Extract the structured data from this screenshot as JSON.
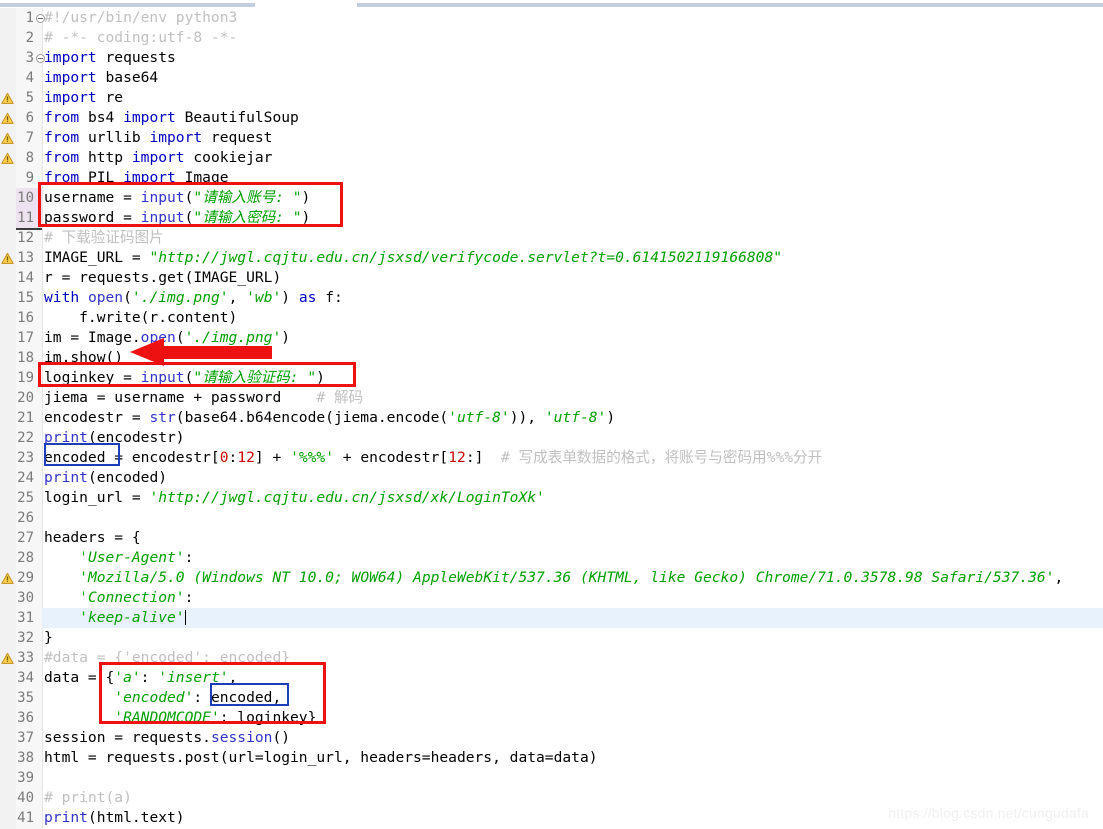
{
  "editor": {
    "title": "python-code-editor",
    "language": "Python",
    "current_line": 31,
    "watermark": "https://blog.csdn.net/cungudafa",
    "colors": {
      "string": "#00a000",
      "keyword": "#7f0055",
      "builtin": "#5050c8",
      "comment": "#c0c0c0",
      "number": "#cc0000",
      "annotation_red": "#ee1111",
      "annotation_blue": "#1b3fbb",
      "current_line_bg": "#e8f2fc",
      "changed_line_bg": "#ede3f0",
      "gutter_bg": "#f7f7f7"
    }
  },
  "lines": [
    {
      "n": 1,
      "warn": false,
      "fold": true,
      "text": "#!/usr/bin/env python3"
    },
    {
      "n": 2,
      "warn": false,
      "fold": false,
      "text": "# -*- coding:utf-8 -*-"
    },
    {
      "n": 3,
      "warn": false,
      "fold": true,
      "text": "import requests"
    },
    {
      "n": 4,
      "warn": false,
      "fold": false,
      "text": "import base64"
    },
    {
      "n": 5,
      "warn": true,
      "fold": false,
      "text": "import re"
    },
    {
      "n": 6,
      "warn": true,
      "fold": false,
      "text": "from bs4 import BeautifulSoup"
    },
    {
      "n": 7,
      "warn": true,
      "fold": false,
      "text": "from urllib import request"
    },
    {
      "n": 8,
      "warn": true,
      "fold": false,
      "text": "from http import cookiejar"
    },
    {
      "n": 9,
      "warn": false,
      "fold": false,
      "text": "from PIL import Image"
    },
    {
      "n": 10,
      "warn": false,
      "fold": false,
      "text": "username = input(\"请输入账号: \")"
    },
    {
      "n": 11,
      "warn": false,
      "fold": false,
      "text": "password = input(\"请输入密码: \")"
    },
    {
      "n": 12,
      "warn": false,
      "fold": false,
      "text": "# 下载验证码图片"
    },
    {
      "n": 13,
      "warn": true,
      "fold": false,
      "text": "IMAGE_URL = \"http://jwgl.cqjtu.edu.cn/jsxsd/verifycode.servlet?t=0.6141502119166808\""
    },
    {
      "n": 14,
      "warn": false,
      "fold": false,
      "text": "r = requests.get(IMAGE_URL)"
    },
    {
      "n": 15,
      "warn": false,
      "fold": false,
      "text": "with open('./img.png', 'wb') as f:"
    },
    {
      "n": 16,
      "warn": false,
      "fold": false,
      "text": "    f.write(r.content)"
    },
    {
      "n": 17,
      "warn": false,
      "fold": false,
      "text": "im = Image.open('./img.png')"
    },
    {
      "n": 18,
      "warn": false,
      "fold": false,
      "text": "im.show()"
    },
    {
      "n": 19,
      "warn": false,
      "fold": false,
      "text": "loginkey = input(\"请输入验证码: \")"
    },
    {
      "n": 20,
      "warn": false,
      "fold": false,
      "text": "jiema = username + password    # 解码"
    },
    {
      "n": 21,
      "warn": false,
      "fold": false,
      "text": "encodestr = str(base64.b64encode(jiema.encode('utf-8')), 'utf-8')"
    },
    {
      "n": 22,
      "warn": false,
      "fold": false,
      "text": "print(encodestr)"
    },
    {
      "n": 23,
      "warn": false,
      "fold": false,
      "text": "encoded = encodestr[0:12] + '%%%' + encodestr[12:]  # 写成表单数据的格式，将账号与密码用%%%分开"
    },
    {
      "n": 24,
      "warn": false,
      "fold": false,
      "text": "print(encoded)"
    },
    {
      "n": 25,
      "warn": false,
      "fold": false,
      "text": "login_url = 'http://jwgl.cqjtu.edu.cn/jsxsd/xk/LoginToXk'"
    },
    {
      "n": 26,
      "warn": false,
      "fold": false,
      "text": ""
    },
    {
      "n": 27,
      "warn": false,
      "fold": false,
      "text": "headers = {"
    },
    {
      "n": 28,
      "warn": false,
      "fold": false,
      "text": "    'User-Agent':"
    },
    {
      "n": 29,
      "warn": true,
      "fold": false,
      "text": "    'Mozilla/5.0 (Windows NT 10.0; WOW64) AppleWebKit/537.36 (KHTML, like Gecko) Chrome/71.0.3578.98 Safari/537.36',"
    },
    {
      "n": 30,
      "warn": false,
      "fold": false,
      "text": "    'Connection':"
    },
    {
      "n": 31,
      "warn": false,
      "fold": false,
      "text": "    'keep-alive'"
    },
    {
      "n": 32,
      "warn": false,
      "fold": false,
      "text": "}"
    },
    {
      "n": 33,
      "warn": true,
      "fold": false,
      "text": "#data = {'encoded': encoded}"
    },
    {
      "n": 34,
      "warn": false,
      "fold": false,
      "text": "data = {'a': 'insert',"
    },
    {
      "n": 35,
      "warn": false,
      "fold": false,
      "text": "        'encoded': encoded,"
    },
    {
      "n": 36,
      "warn": false,
      "fold": false,
      "text": "        'RANDOMCODE': loginkey}"
    },
    {
      "n": 37,
      "warn": false,
      "fold": false,
      "text": "session = requests.session()"
    },
    {
      "n": 38,
      "warn": false,
      "fold": false,
      "text": "html = requests.post(url=login_url, headers=headers, data=data)"
    },
    {
      "n": 39,
      "warn": false,
      "fold": false,
      "text": ""
    },
    {
      "n": 40,
      "warn": false,
      "fold": false,
      "text": "# print(a)"
    },
    {
      "n": 41,
      "warn": false,
      "fold": false,
      "text": "print(html.text)"
    }
  ],
  "annotations": [
    {
      "id": "box-credentials-input",
      "shape": "rect",
      "color": "#ee1111",
      "covers_lines": "10-11"
    },
    {
      "id": "box-loginkey-input",
      "shape": "rect",
      "color": "#ee1111",
      "covers_lines": "19"
    },
    {
      "id": "box-encoded-variable",
      "shape": "rect",
      "color": "#1b3fbb",
      "covers_lines": "23"
    },
    {
      "id": "box-data-dict",
      "shape": "rect",
      "color": "#ee1111",
      "covers_lines": "34-36"
    },
    {
      "id": "box-encoded-value",
      "shape": "rect",
      "color": "#1b3fbb",
      "covers_lines": "35"
    },
    {
      "id": "arrow-im-show",
      "shape": "arrow",
      "color": "#ee1111",
      "points_at_line": 18
    }
  ]
}
